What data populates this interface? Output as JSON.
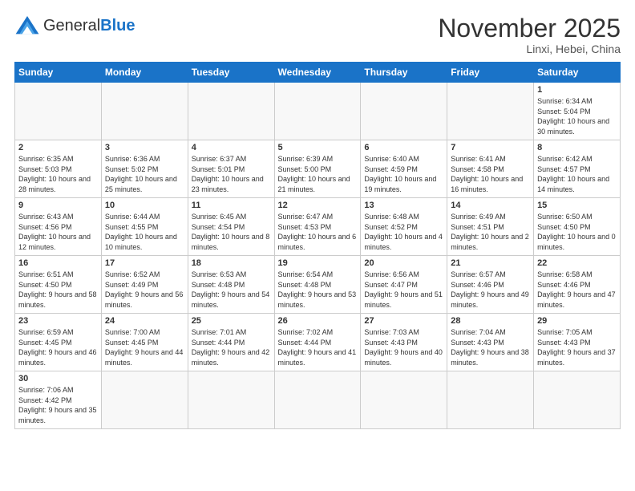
{
  "header": {
    "logo_general": "General",
    "logo_blue": "Blue",
    "month_title": "November 2025",
    "location": "Linxi, Hebei, China"
  },
  "days_of_week": [
    "Sunday",
    "Monday",
    "Tuesday",
    "Wednesday",
    "Thursday",
    "Friday",
    "Saturday"
  ],
  "weeks": [
    [
      {
        "day": "",
        "info": ""
      },
      {
        "day": "",
        "info": ""
      },
      {
        "day": "",
        "info": ""
      },
      {
        "day": "",
        "info": ""
      },
      {
        "day": "",
        "info": ""
      },
      {
        "day": "",
        "info": ""
      },
      {
        "day": "1",
        "info": "Sunrise: 6:34 AM\nSunset: 5:04 PM\nDaylight: 10 hours and 30 minutes."
      }
    ],
    [
      {
        "day": "2",
        "info": "Sunrise: 6:35 AM\nSunset: 5:03 PM\nDaylight: 10 hours and 28 minutes."
      },
      {
        "day": "3",
        "info": "Sunrise: 6:36 AM\nSunset: 5:02 PM\nDaylight: 10 hours and 25 minutes."
      },
      {
        "day": "4",
        "info": "Sunrise: 6:37 AM\nSunset: 5:01 PM\nDaylight: 10 hours and 23 minutes."
      },
      {
        "day": "5",
        "info": "Sunrise: 6:39 AM\nSunset: 5:00 PM\nDaylight: 10 hours and 21 minutes."
      },
      {
        "day": "6",
        "info": "Sunrise: 6:40 AM\nSunset: 4:59 PM\nDaylight: 10 hours and 19 minutes."
      },
      {
        "day": "7",
        "info": "Sunrise: 6:41 AM\nSunset: 4:58 PM\nDaylight: 10 hours and 16 minutes."
      },
      {
        "day": "8",
        "info": "Sunrise: 6:42 AM\nSunset: 4:57 PM\nDaylight: 10 hours and 14 minutes."
      }
    ],
    [
      {
        "day": "9",
        "info": "Sunrise: 6:43 AM\nSunset: 4:56 PM\nDaylight: 10 hours and 12 minutes."
      },
      {
        "day": "10",
        "info": "Sunrise: 6:44 AM\nSunset: 4:55 PM\nDaylight: 10 hours and 10 minutes."
      },
      {
        "day": "11",
        "info": "Sunrise: 6:45 AM\nSunset: 4:54 PM\nDaylight: 10 hours and 8 minutes."
      },
      {
        "day": "12",
        "info": "Sunrise: 6:47 AM\nSunset: 4:53 PM\nDaylight: 10 hours and 6 minutes."
      },
      {
        "day": "13",
        "info": "Sunrise: 6:48 AM\nSunset: 4:52 PM\nDaylight: 10 hours and 4 minutes."
      },
      {
        "day": "14",
        "info": "Sunrise: 6:49 AM\nSunset: 4:51 PM\nDaylight: 10 hours and 2 minutes."
      },
      {
        "day": "15",
        "info": "Sunrise: 6:50 AM\nSunset: 4:50 PM\nDaylight: 10 hours and 0 minutes."
      }
    ],
    [
      {
        "day": "16",
        "info": "Sunrise: 6:51 AM\nSunset: 4:50 PM\nDaylight: 9 hours and 58 minutes."
      },
      {
        "day": "17",
        "info": "Sunrise: 6:52 AM\nSunset: 4:49 PM\nDaylight: 9 hours and 56 minutes."
      },
      {
        "day": "18",
        "info": "Sunrise: 6:53 AM\nSunset: 4:48 PM\nDaylight: 9 hours and 54 minutes."
      },
      {
        "day": "19",
        "info": "Sunrise: 6:54 AM\nSunset: 4:48 PM\nDaylight: 9 hours and 53 minutes."
      },
      {
        "day": "20",
        "info": "Sunrise: 6:56 AM\nSunset: 4:47 PM\nDaylight: 9 hours and 51 minutes."
      },
      {
        "day": "21",
        "info": "Sunrise: 6:57 AM\nSunset: 4:46 PM\nDaylight: 9 hours and 49 minutes."
      },
      {
        "day": "22",
        "info": "Sunrise: 6:58 AM\nSunset: 4:46 PM\nDaylight: 9 hours and 47 minutes."
      }
    ],
    [
      {
        "day": "23",
        "info": "Sunrise: 6:59 AM\nSunset: 4:45 PM\nDaylight: 9 hours and 46 minutes."
      },
      {
        "day": "24",
        "info": "Sunrise: 7:00 AM\nSunset: 4:45 PM\nDaylight: 9 hours and 44 minutes."
      },
      {
        "day": "25",
        "info": "Sunrise: 7:01 AM\nSunset: 4:44 PM\nDaylight: 9 hours and 42 minutes."
      },
      {
        "day": "26",
        "info": "Sunrise: 7:02 AM\nSunset: 4:44 PM\nDaylight: 9 hours and 41 minutes."
      },
      {
        "day": "27",
        "info": "Sunrise: 7:03 AM\nSunset: 4:43 PM\nDaylight: 9 hours and 40 minutes."
      },
      {
        "day": "28",
        "info": "Sunrise: 7:04 AM\nSunset: 4:43 PM\nDaylight: 9 hours and 38 minutes."
      },
      {
        "day": "29",
        "info": "Sunrise: 7:05 AM\nSunset: 4:43 PM\nDaylight: 9 hours and 37 minutes."
      }
    ],
    [
      {
        "day": "30",
        "info": "Sunrise: 7:06 AM\nSunset: 4:42 PM\nDaylight: 9 hours and 35 minutes."
      },
      {
        "day": "",
        "info": ""
      },
      {
        "day": "",
        "info": ""
      },
      {
        "day": "",
        "info": ""
      },
      {
        "day": "",
        "info": ""
      },
      {
        "day": "",
        "info": ""
      },
      {
        "day": "",
        "info": ""
      }
    ]
  ]
}
